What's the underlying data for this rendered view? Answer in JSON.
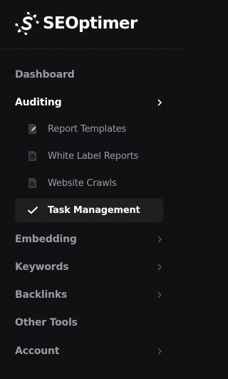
{
  "brand": {
    "name": "SEOptimer",
    "logo_icon": "gear-s-logo-icon"
  },
  "colors": {
    "background": "#111113",
    "selected_background": "#1f1f22",
    "text_active": "#ffffff",
    "text_muted": "#9a9aa5"
  },
  "nav": {
    "dashboard": "Dashboard",
    "auditing": "Auditing",
    "embedding": "Embedding",
    "keywords": "Keywords",
    "backlinks": "Backlinks",
    "other_tools": "Other Tools",
    "account": "Account"
  },
  "auditing_sub": {
    "report_templates": "Report Templates",
    "white_label_reports": "White Label Reports",
    "website_crawls": "Website Crawls",
    "task_management": "Task Management"
  },
  "icons": {
    "report_templates": "file-pen-icon",
    "white_label_reports": "file-chart-icon",
    "website_crawls": "file-search-icon",
    "task_management": "check-icon",
    "chevron": "chevron-right-icon"
  },
  "state": {
    "expanded_section": "Auditing",
    "selected_item": "Task Management"
  }
}
